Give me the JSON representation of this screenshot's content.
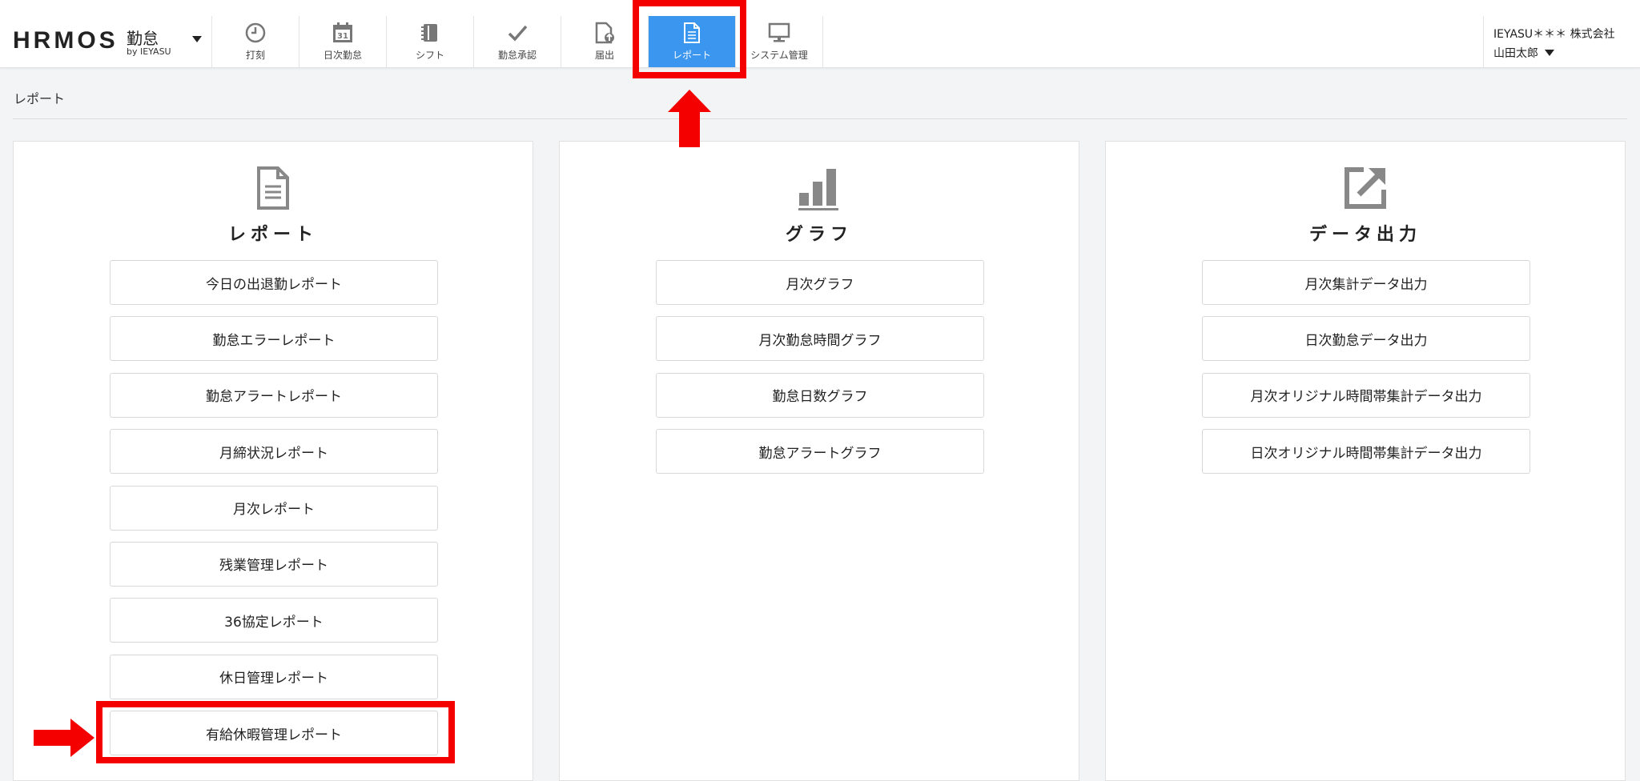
{
  "app": {
    "logo_main": "HRMOS",
    "logo_product": "勤怠",
    "logo_by": "by IEYASU"
  },
  "nav": [
    {
      "label": "打刻",
      "icon": "clock-icon"
    },
    {
      "label": "日次勤怠",
      "icon": "calendar-icon"
    },
    {
      "label": "シフト",
      "icon": "notebook-icon"
    },
    {
      "label": "勤怠承認",
      "icon": "checkmark-icon"
    },
    {
      "label": "届出",
      "icon": "document-upload-icon"
    },
    {
      "label": "レポート",
      "icon": "document-icon",
      "active": true
    },
    {
      "label": "システム管理",
      "icon": "monitor-icon"
    }
  ],
  "user": {
    "company": "IEYASU＊＊＊ 株式会社",
    "name": "山田太郎"
  },
  "breadcrumb": "レポート",
  "cards": [
    {
      "title": "レポート",
      "icon": "document-icon",
      "buttons": [
        "今日の出退勤レポート",
        "勤怠エラーレポート",
        "勤怠アラートレポート",
        "月締状況レポート",
        "月次レポート",
        "残業管理レポート",
        "36協定レポート",
        "休日管理レポート",
        "有給休暇管理レポート"
      ]
    },
    {
      "title": "グラフ",
      "icon": "bar-chart-icon",
      "buttons": [
        "月次グラフ",
        "月次勤怠時間グラフ",
        "勤怠日数グラフ",
        "勤怠アラートグラフ"
      ]
    },
    {
      "title": "データ出力",
      "icon": "external-link-icon",
      "buttons": [
        "月次集計データ出力",
        "日次勤怠データ出力",
        "月次オリジナル時間帯集計データ出力",
        "日次オリジナル時間帯集計データ出力"
      ]
    }
  ],
  "colors": {
    "accent": "#3b96f0",
    "annotation": "#f40000"
  }
}
